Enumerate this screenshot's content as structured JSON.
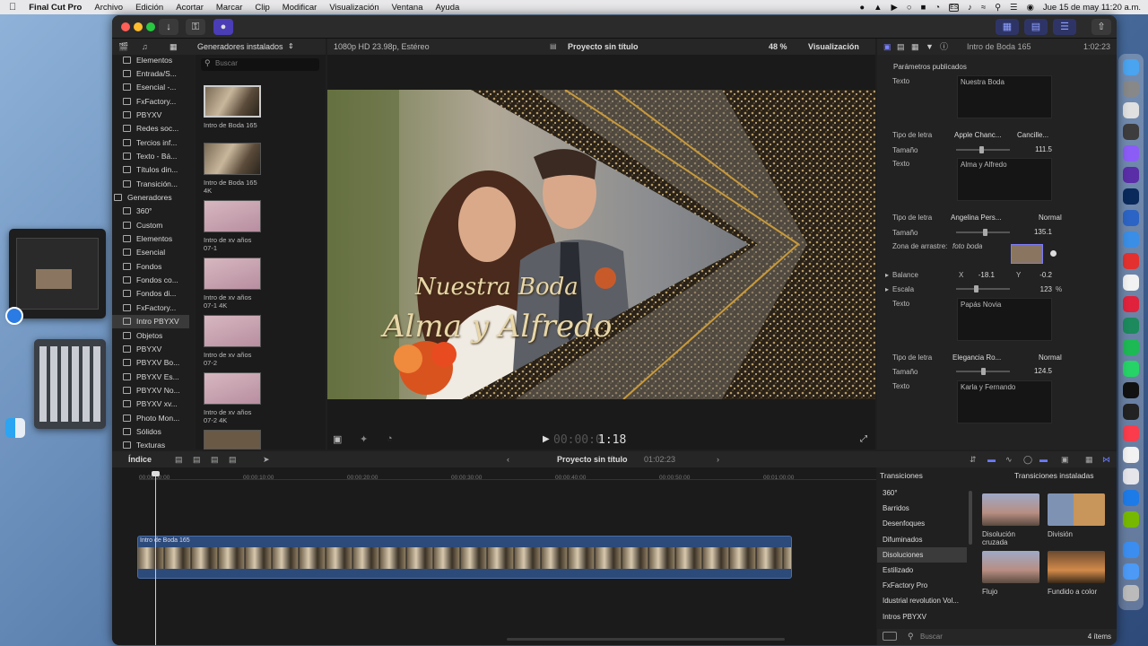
{
  "menubar": {
    "app": "Final Cut Pro",
    "items": [
      "Archivo",
      "Edición",
      "Acortar",
      "Marcar",
      "Clip",
      "Modificar",
      "Visualización",
      "Ventana",
      "Ayuda"
    ],
    "status_es": "ES",
    "datetime": "Jue 15 de may  11:20 a.m."
  },
  "browser": {
    "filter": "Generadores instalados",
    "search_placeholder": "Buscar",
    "sidebar": [
      {
        "label": "Elementos"
      },
      {
        "label": "Entrada/S..."
      },
      {
        "label": "Esencial -..."
      },
      {
        "label": "FxFactory..."
      },
      {
        "label": "PBYXV"
      },
      {
        "label": "Redes soc..."
      },
      {
        "label": "Tercios inf..."
      },
      {
        "label": "Texto - Bá..."
      },
      {
        "label": "Títulos din..."
      },
      {
        "label": "Transición..."
      },
      {
        "label": "Generadores"
      },
      {
        "label": "360°"
      },
      {
        "label": "Custom"
      },
      {
        "label": "Elementos"
      },
      {
        "label": "Esencial"
      },
      {
        "label": "Fondos"
      },
      {
        "label": "Fondos co..."
      },
      {
        "label": "Fondos di..."
      },
      {
        "label": "FxFactory..."
      },
      {
        "label": "Intro PBYXV"
      },
      {
        "label": "Objetos"
      },
      {
        "label": "PBYXV"
      },
      {
        "label": "PBYXV Bo..."
      },
      {
        "label": "PBYXV Es..."
      },
      {
        "label": "PBYXV No..."
      },
      {
        "label": "PBYXV xv..."
      },
      {
        "label": "Photo Mon..."
      },
      {
        "label": "Sólidos"
      },
      {
        "label": "Texturas"
      }
    ],
    "generators": [
      {
        "name": "Intro de Boda 165"
      },
      {
        "name": "Intro de Boda 165 4K"
      },
      {
        "name": "Intro de xv años 07-1"
      },
      {
        "name": "Intro de xv años 07-1 4K"
      },
      {
        "name": "Intro de xv años 07-2"
      },
      {
        "name": "Intro de xv años 07-2 4K"
      }
    ]
  },
  "viewer": {
    "format": "1080p HD 23.98p, Estéreo",
    "project": "Proyecto sin título",
    "zoom": "48 %",
    "view_menu": "Visualización",
    "title_line1": "Nuestra Boda",
    "title_line2": "Alma y Alfredo",
    "timecode_dim": "00:00:0",
    "timecode": "1:18"
  },
  "inspector": {
    "clip_name": "Intro de Boda 165",
    "duration": "1:02:23",
    "section": "Parámetros publicados",
    "texto_label": "Texto",
    "tipo_label": "Tipo de letra",
    "tamano_label": "Tamaño",
    "text1": "Nuestra Boda",
    "font1": "Apple Chanc...",
    "style1": "Cancille...",
    "size1": "111.5",
    "text2": "Alma y Alfredo",
    "font2": "Angelina Pers...",
    "style2": "Normal",
    "size2": "135.1",
    "dropzone_label": "Zona de arrastre:",
    "dropzone_value": "foto boda",
    "balance_label": "Balance",
    "balance_x_label": "X",
    "balance_x": "-18.1",
    "balance_y_label": "Y",
    "balance_y": "-0.2",
    "escala_label": "Escala",
    "escala": "123",
    "escala_unit": "%",
    "text3": "Papás Novia",
    "font3": "Elegancia Ro...",
    "style3": "Normal",
    "size3": "124.5",
    "text4": "Karla y Fernando"
  },
  "timeline": {
    "index_label": "Índice",
    "project": "Proyecto sin título",
    "duration": "01:02:23",
    "ruler": [
      "00:00:00:00",
      "00:00:10:00",
      "00:00:20:00",
      "00:00:30:00",
      "00:00:40:00",
      "00:00:50:00",
      "00:01:00:00"
    ],
    "clip_name": "Intro de Boda 165"
  },
  "transitions": {
    "title": "Transiciones",
    "filter": "Transiciones instaladas",
    "categories": [
      "360°",
      "Barridos",
      "Desenfoques",
      "Difuminados",
      "Disoluciones",
      "Estilizado",
      "FxFactory Pro",
      "Idustrial revolution Vol...",
      "Intros PBYXV"
    ],
    "items": [
      {
        "name": "Disolución cruzada"
      },
      {
        "name": "División"
      },
      {
        "name": "Flujo"
      },
      {
        "name": "Fundido a color"
      }
    ],
    "search_placeholder": "Buscar",
    "count": "4 ítems"
  },
  "colors": {
    "accent": "#4a6ef0",
    "clip_blue": "#2c4a7a",
    "gold": "#d6b97a"
  }
}
